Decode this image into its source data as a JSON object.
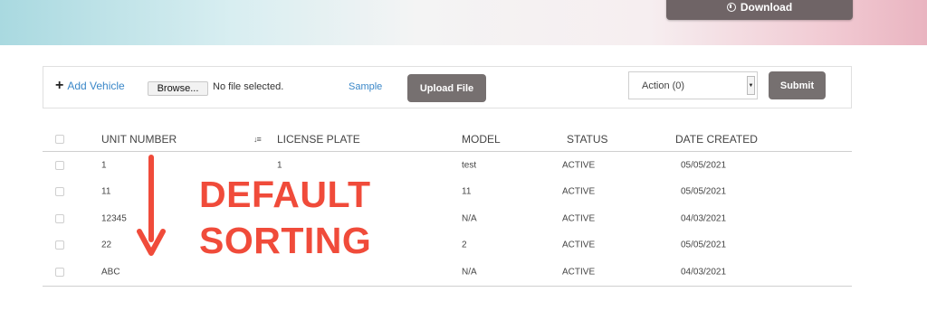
{
  "header": {
    "download_label": "Download",
    "download_icon": "download-circle-icon"
  },
  "toolbar": {
    "add_vehicle_label": "Add Vehicle",
    "add_icon": "plus-icon",
    "browse_label": "Browse...",
    "file_status": "No file selected.",
    "sample_label": "Sample",
    "upload_label": "Upload File",
    "action_select_value": "Action (0)",
    "submit_label": "Submit"
  },
  "table": {
    "columns": [
      "UNIT NUMBER",
      "LICENSE PLATE",
      "MODEL",
      "STATUS",
      "DATE CREATED"
    ],
    "sort_icon": "sort-descending-icon",
    "rows": [
      {
        "unit": "1",
        "plate": "1",
        "model": "test",
        "status": "ACTIVE",
        "date": "05/05/2021"
      },
      {
        "unit": "11",
        "plate": "",
        "model": "11",
        "status": "ACTIVE",
        "date": "05/05/2021"
      },
      {
        "unit": "12345",
        "plate": "",
        "model": "N/A",
        "status": "ACTIVE",
        "date": "04/03/2021"
      },
      {
        "unit": "22",
        "plate": "",
        "model": "2",
        "status": "ACTIVE",
        "date": "05/05/2021"
      },
      {
        "unit": "ABC",
        "plate": "",
        "model": "N/A",
        "status": "ACTIVE",
        "date": "04/03/2021"
      }
    ]
  },
  "annotation": {
    "line1": "DEFAULT",
    "line2": "SORTING",
    "color": "#f04b3a"
  },
  "colors": {
    "link": "#3a87c8",
    "button_gray": "#767070",
    "download_btn": "#6f6466"
  }
}
